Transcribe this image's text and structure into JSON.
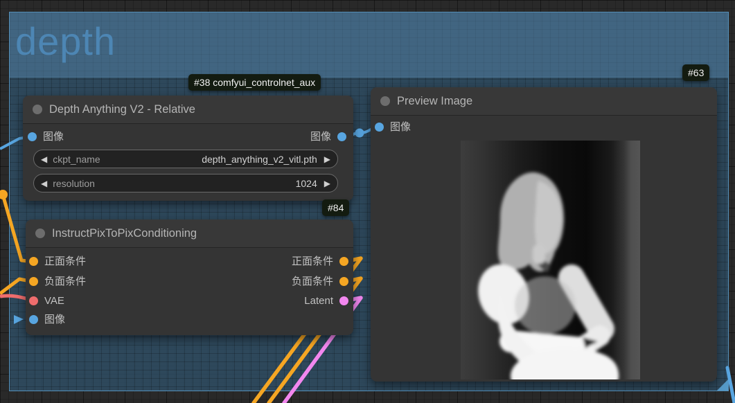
{
  "group": {
    "title": "depth"
  },
  "badges": [
    {
      "label": "#38 comfyui_controlnet_aux"
    },
    {
      "label": "#84"
    },
    {
      "label": "#63"
    }
  ],
  "icons": {
    "combo_left": "◀",
    "combo_right": "▶"
  },
  "nodes": {
    "depth_anything_v2": {
      "title": "Depth Anything V2 - Relative",
      "inputs": [
        {
          "label": "图像",
          "type": "IMAGE"
        }
      ],
      "outputs": [
        {
          "label": "图像",
          "type": "IMAGE"
        }
      ],
      "widgets": [
        {
          "name": "ckpt_name",
          "value": "depth_anything_v2_vitl.pth"
        },
        {
          "name": "resolution",
          "value": "1024"
        }
      ]
    },
    "instruct_pix_to_pix": {
      "title": "InstructPixToPixConditioning",
      "inputs": [
        {
          "label": "正面条件",
          "type": "CONDITIONING"
        },
        {
          "label": "负面条件",
          "type": "CONDITIONING"
        },
        {
          "label": "VAE",
          "type": "VAE"
        },
        {
          "label": "图像",
          "type": "IMAGE"
        }
      ],
      "outputs": [
        {
          "label": "正面条件",
          "type": "CONDITIONING"
        },
        {
          "label": "负面条件",
          "type": "CONDITIONING"
        },
        {
          "label": "Latent",
          "type": "LATENT"
        }
      ]
    },
    "preview_image": {
      "title": "Preview Image",
      "inputs": [
        {
          "label": "图像",
          "type": "IMAGE"
        }
      ]
    }
  },
  "colors": {
    "image_slot": "#58a5e0",
    "conditioning_slot": "#f5a623",
    "vae_slot": "#ef6d6d",
    "latent_slot": "#f287ef",
    "group_header": "#3c688c",
    "group_body": "#2b4a61",
    "node_bg": "#353535",
    "badge_bg": "#131b10"
  }
}
